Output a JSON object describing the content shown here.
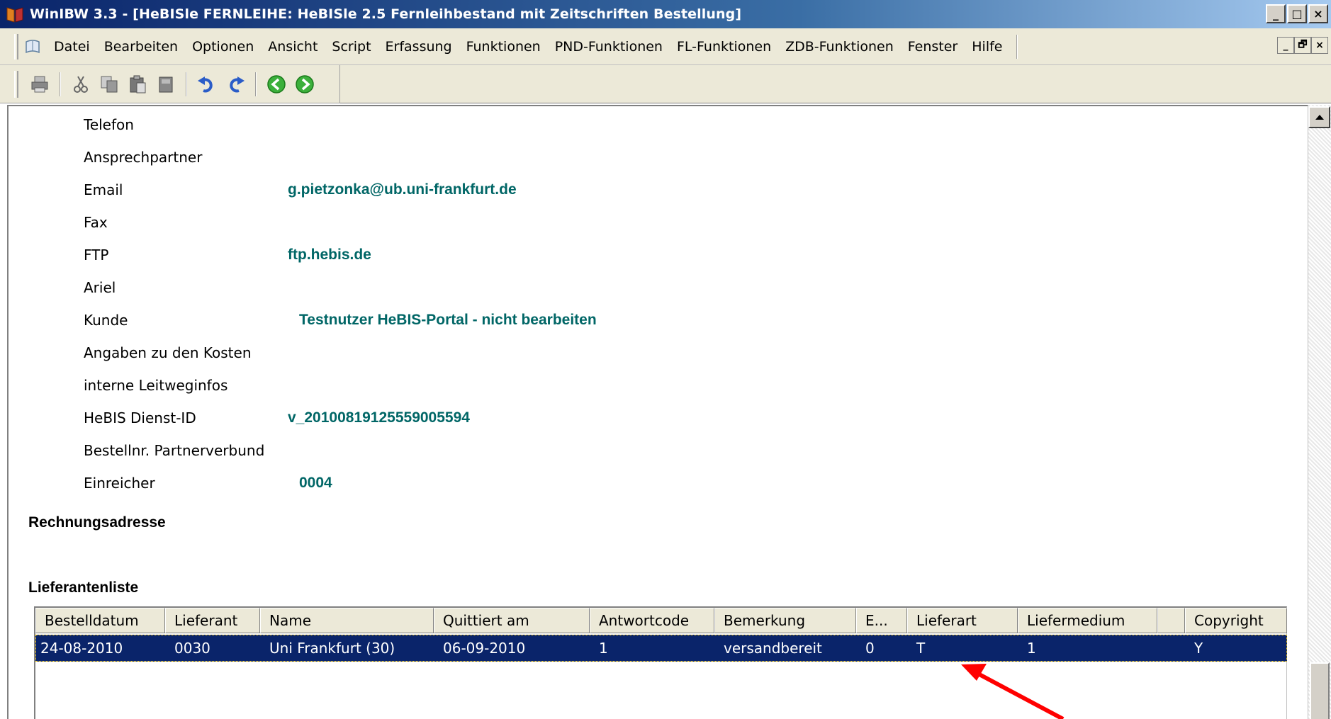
{
  "window": {
    "title": "WinIBW 3.3 - [HeBISle FERNLEIHE: HeBISle 2.5 Fernleihbestand mit Zeitschriften Bestellung]",
    "minimize": "_",
    "maximize": "□",
    "close": "×",
    "restore": "🗗"
  },
  "menu": {
    "items": [
      "Datei",
      "Bearbeiten",
      "Optionen",
      "Ansicht",
      "Script",
      "Erfassung",
      "Funktionen",
      "PND-Funktionen",
      "FL-Funktionen",
      "ZDB-Funktionen",
      "Fenster",
      "Hilfe"
    ]
  },
  "fields": [
    {
      "label": "Telefon",
      "value": ""
    },
    {
      "label": "Ansprechpartner",
      "value": ""
    },
    {
      "label": "Email",
      "value": "g.pietzonka@ub.uni-frankfurt.de"
    },
    {
      "label": "Fax",
      "value": ""
    },
    {
      "label": "FTP",
      "value": "ftp.hebis.de"
    },
    {
      "label": "Ariel",
      "value": ""
    },
    {
      "label": "Kunde",
      "value": "Testnutzer HeBIS-Portal - nicht bearbeiten"
    },
    {
      "label": "Angaben zu den Kosten",
      "value": ""
    },
    {
      "label": "interne Leitweginfos",
      "value": ""
    },
    {
      "label": "HeBIS Dienst-ID",
      "value": "v_20100819125559005594"
    },
    {
      "label": "Bestellnr. Partnerverbund",
      "value": ""
    },
    {
      "label": "Einreicher",
      "value": "0004"
    }
  ],
  "sections": {
    "billing": "Rechnungsadresse",
    "suppliers": "Lieferantenliste"
  },
  "table": {
    "columns": [
      "Bestelldatum",
      "Lieferant",
      "Name",
      "Quittiert am",
      "Antwortcode",
      "Bemerkung",
      "E...",
      "Lieferart",
      "Liefermedium",
      "",
      "Copyright"
    ],
    "rows": [
      [
        "24-08-2010",
        "0030",
        "Uni Frankfurt (30)",
        "06-09-2010",
        "1",
        "versandbereit",
        "0",
        "T",
        "1",
        "",
        "Y"
      ]
    ]
  },
  "colors": {
    "accent_value": "#006666",
    "selection": "#0a246a",
    "arrow": "#ff0000"
  }
}
